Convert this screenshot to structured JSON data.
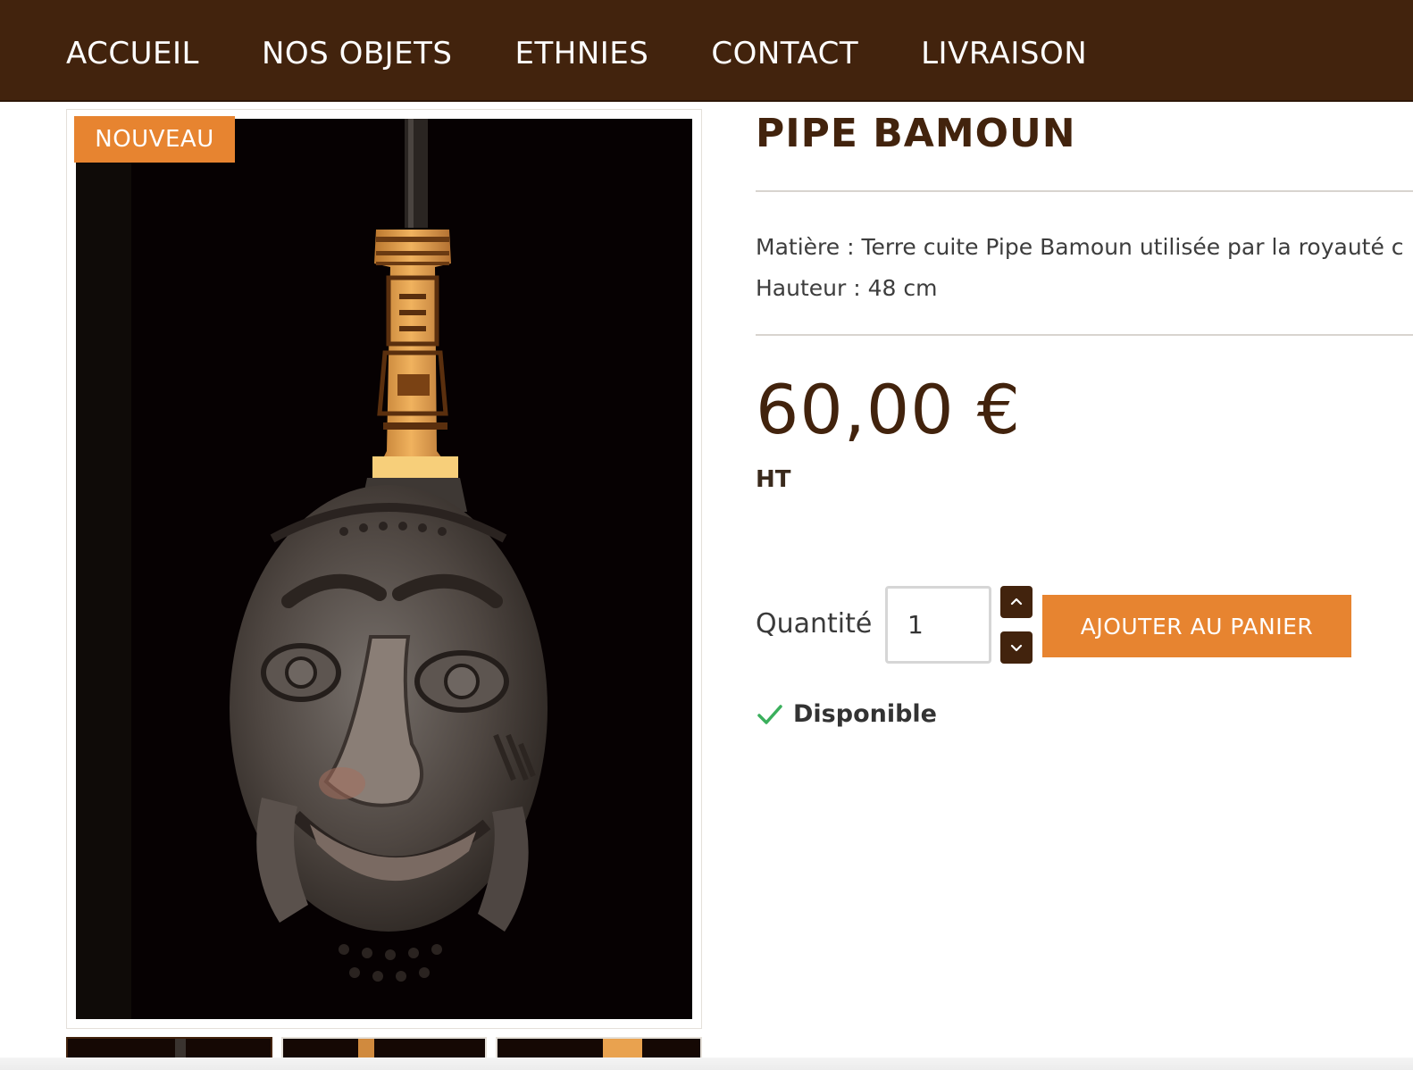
{
  "nav": {
    "items": [
      "ACCUEIL",
      "NOS OBJETS",
      "ETHNIES",
      "CONTACT",
      "LIVRAISON"
    ]
  },
  "product": {
    "badge": "NOUVEAU",
    "title": "PIPE BAMOUN",
    "description_line1": "Matière : Terre cuite Pipe Bamoun utilisée par la royauté c",
    "description_line2": "Hauteur : 48 cm",
    "price": "60,00 €",
    "tax_label": "HT",
    "quantity_label": "Quantité",
    "quantity_value": "1",
    "add_to_cart_label": "AJOUTER AU PANIER",
    "availability": "Disponible"
  },
  "colors": {
    "brand_dark_brown": "#42230d",
    "accent_orange": "#e78430",
    "available_green": "#3aaf5c"
  },
  "icons": [
    "chevron-up-icon",
    "chevron-down-icon",
    "check-icon"
  ]
}
